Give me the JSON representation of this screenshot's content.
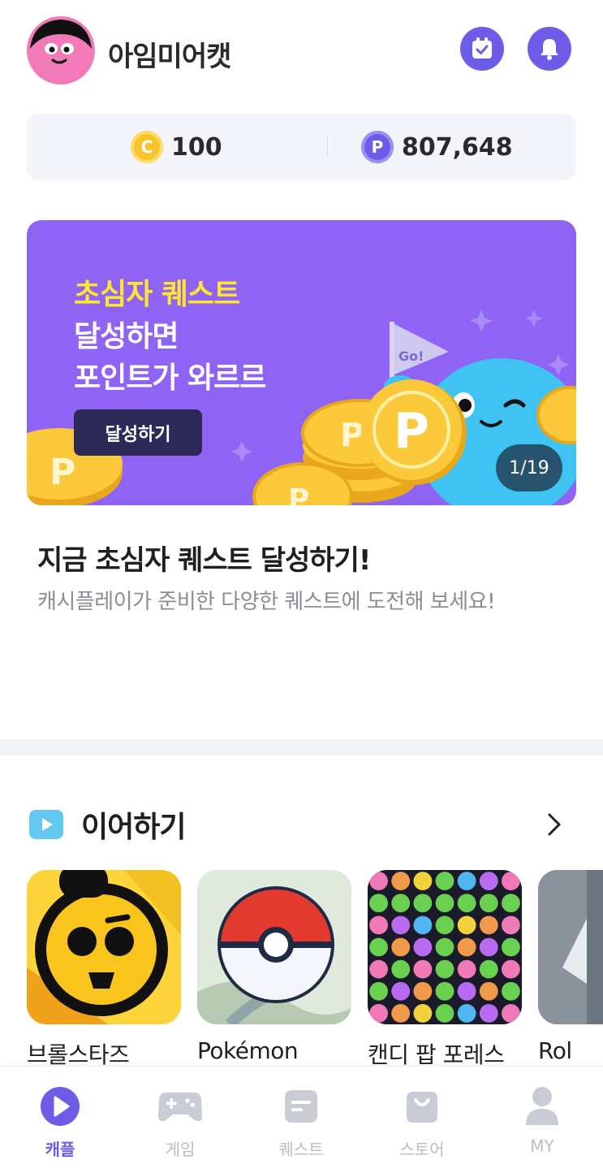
{
  "header": {
    "username": "아임미어캣"
  },
  "balance": {
    "coin_symbol": "C",
    "coin_value": "100",
    "point_symbol": "P",
    "point_value": "807,648"
  },
  "banner": {
    "line1": "초심자 퀘스트",
    "line2": "달성하면",
    "line3": "포인트가 와르르",
    "cta": "달성하기",
    "flag_text": "Go!",
    "pager": "1/19"
  },
  "promo": {
    "title": "지금 초심자 퀘스트 달성하기!",
    "subtitle": "캐시플레이가 준비한 다양한 퀘스트에 도전해 보세요!"
  },
  "continue_section": {
    "title": "이어하기",
    "games": [
      {
        "name": "브롤스타즈"
      },
      {
        "name": "Pokémon"
      },
      {
        "name": "캔디 팝 포레스"
      },
      {
        "name": "Rol"
      }
    ]
  },
  "bottom_nav": {
    "items": [
      {
        "label": "캐플",
        "icon": "play-circle-icon",
        "active": true
      },
      {
        "label": "게임",
        "icon": "gamepad-icon",
        "active": false
      },
      {
        "label": "퀘스트",
        "icon": "quest-card-icon",
        "active": false
      },
      {
        "label": "스토어",
        "icon": "shopping-bag-icon",
        "active": false
      },
      {
        "label": "MY",
        "icon": "person-icon",
        "active": false
      }
    ]
  },
  "colors": {
    "accent": "#6c5ce7",
    "banner_bg": "#8f63f4",
    "banner_highlight": "#ffe62e",
    "coin": "#f7c32e",
    "inactive_nav": "#b8bcc6"
  }
}
